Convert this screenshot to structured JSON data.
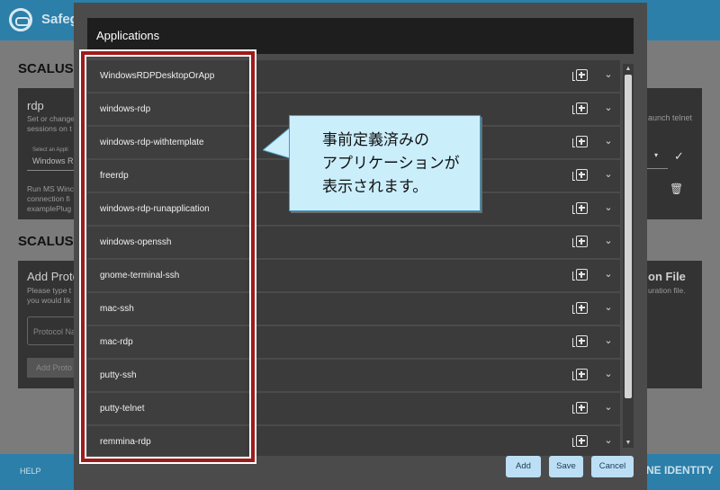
{
  "background": {
    "app_name": "Safeg",
    "section1_heading": "SCALUS",
    "card1": {
      "title": "rdp",
      "desc": [
        "Set or change",
        "sessions on t"
      ],
      "select_label": "Select an Appli",
      "select_value": "Windows R",
      "note": [
        "Run MS Winc",
        "connection fi",
        "examplePlug"
      ]
    },
    "right_text": "aunch telnet",
    "section2_heading": "SCALUS",
    "card2": {
      "title": "Add Proto",
      "desc": [
        "Please type t",
        "you would lik"
      ],
      "input_placeholder": "Protocol Na",
      "button_label": "Add Proto"
    },
    "right_title": "on File",
    "right_desc": "uration file.",
    "footer_help": "HELP",
    "footer_identity": "NE IDENTITY"
  },
  "modal": {
    "title": "Applications",
    "applications": [
      "WindowsRDPDesktopOrApp",
      "windows-rdp",
      "windows-rdp-withtemplate",
      "freerdp",
      "windows-rdp-runapplication",
      "windows-openssh",
      "gnome-terminal-ssh",
      "mac-ssh",
      "mac-rdp",
      "putty-ssh",
      "putty-telnet",
      "remmina-rdp"
    ],
    "buttons": {
      "add": "Add",
      "save": "Save",
      "cancel": "Cancel"
    }
  },
  "callout": {
    "lines": [
      "事前定義済みの",
      "アプリケーションが",
      "表示されます。"
    ]
  }
}
